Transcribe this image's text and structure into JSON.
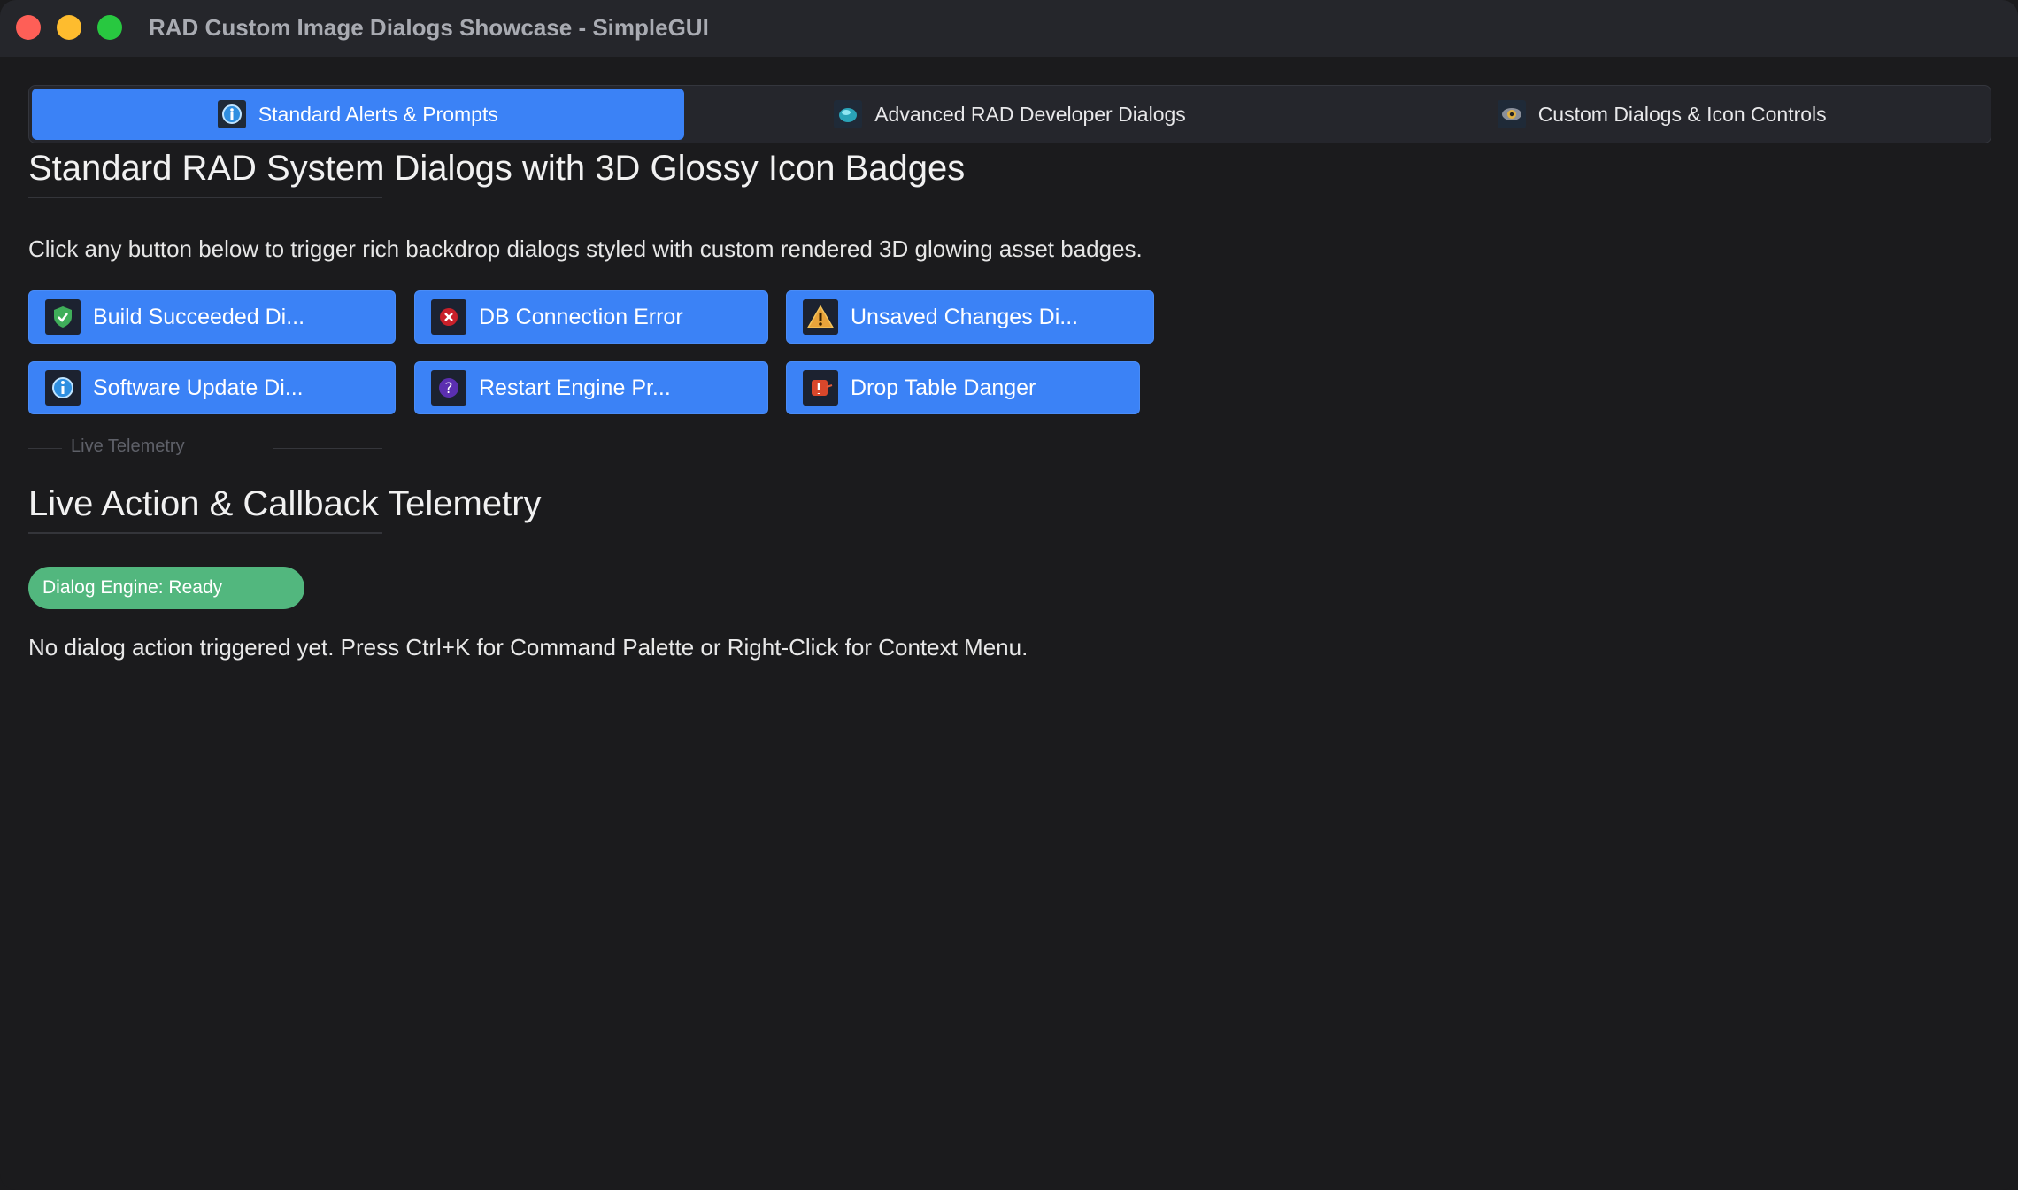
{
  "window": {
    "title": "RAD Custom Image Dialogs Showcase - SimpleGUI"
  },
  "tabs": [
    {
      "label": "Standard Alerts & Prompts",
      "icon": "info-badge-icon",
      "active": true
    },
    {
      "label": "Advanced RAD Developer Dialogs",
      "icon": "gem-icon",
      "active": false
    },
    {
      "label": "Custom Dialogs & Icon Controls",
      "icon": "eye-icon",
      "active": false
    }
  ],
  "section1": {
    "heading": "Standard RAD System Dialogs with 3D Glossy Icon Badges",
    "description": "Click any button below to trigger rich backdrop dialogs styled with custom rendered 3D glowing asset badges."
  },
  "buttons": [
    {
      "label": "Build Succeeded Di...",
      "icon": "shield-check-icon"
    },
    {
      "label": "DB Connection Error",
      "icon": "error-x-icon"
    },
    {
      "label": "Unsaved Changes Di...",
      "icon": "warning-triangle-icon"
    },
    {
      "label": "Software Update Di...",
      "icon": "info-badge-icon"
    },
    {
      "label": "Restart Engine Pr...",
      "icon": "question-icon"
    },
    {
      "label": "Drop Table Danger",
      "icon": "danger-icon"
    }
  ],
  "separator": {
    "label": "Live Telemetry"
  },
  "section2": {
    "heading": "Live Action & Callback Telemetry",
    "badge": "Dialog Engine: Ready",
    "status": "No dialog action triggered yet. Press Ctrl+K for Command Palette or Right-Click for Context Menu."
  },
  "colors": {
    "accent": "#3b82f6",
    "success_badge": "#52b77e",
    "background": "#1b1b1d",
    "titlebar": "#25262b"
  }
}
